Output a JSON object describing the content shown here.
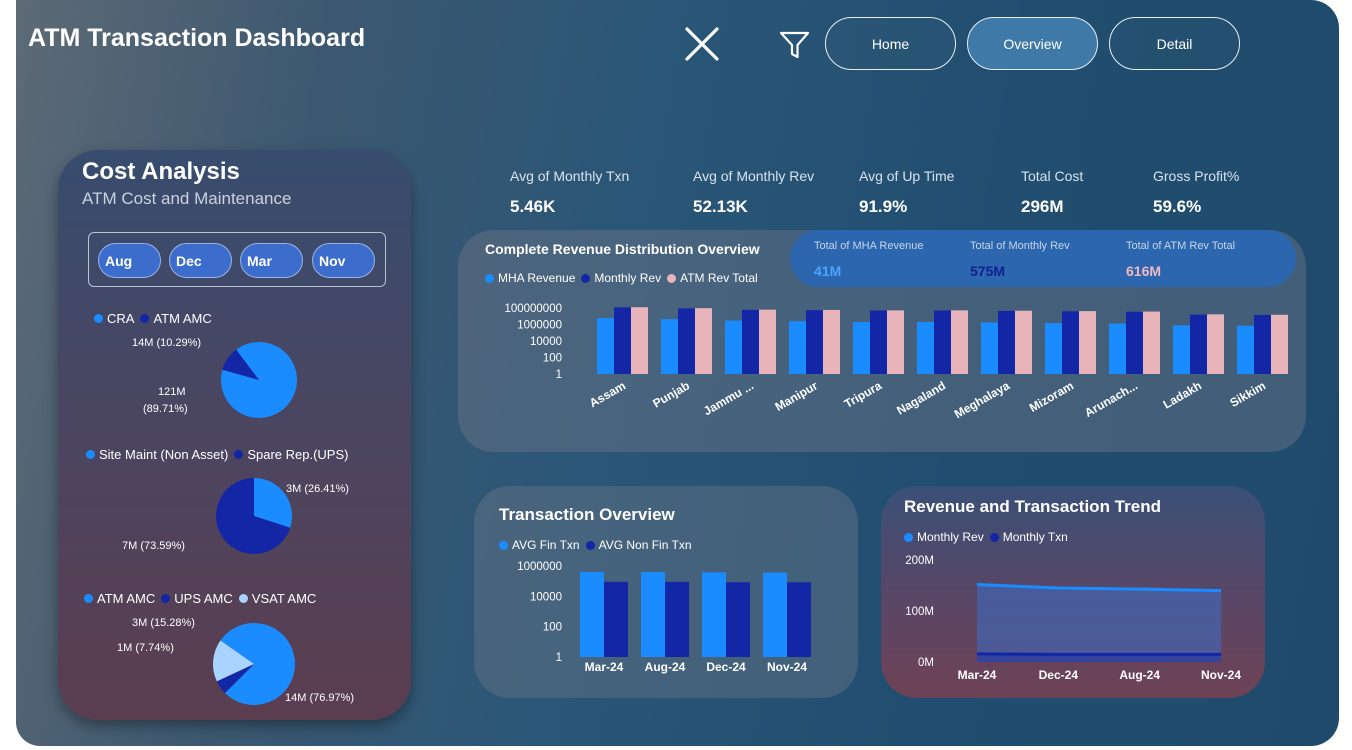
{
  "header": {
    "title": "ATM Transaction Dashboard",
    "nav": [
      {
        "label": "Home",
        "active": false
      },
      {
        "label": "Overview",
        "active": true
      },
      {
        "label": "Detail",
        "active": false
      }
    ],
    "icons": [
      "close-icon",
      "filter-icon"
    ]
  },
  "colors": {
    "bright_blue": "#1a8cff",
    "navy": "#1226a6",
    "pink": "#e8b4bb",
    "light_blue": "#a8d4ff",
    "strip_blue": "#2b66ae"
  },
  "cost_card": {
    "title": "Cost Analysis",
    "subtitle": "ATM Cost and Maintenance",
    "months": [
      "Aug",
      "Dec",
      "Mar",
      "Nov"
    ]
  },
  "kpis": [
    {
      "label": "Avg of Monthly Txn",
      "value": "5.46K"
    },
    {
      "label": "Avg of Monthly Rev",
      "value": "52.13K"
    },
    {
      "label": "Avg of Up Time",
      "value": "91.9%"
    },
    {
      "label": "Total Cost",
      "value": "296M"
    },
    {
      "label": "Gross Profit%",
      "value": "59.6%"
    }
  ],
  "revenue_strip": [
    {
      "label": "Total of MHA Revenue",
      "value": "41M",
      "color": "#4da3ff"
    },
    {
      "label": "Total of Monthly Rev",
      "value": "575M",
      "color": "#11208f"
    },
    {
      "label": "Total of ATM Rev Total",
      "value": "616M",
      "color": "#f0b8c0"
    }
  ],
  "chart_data": [
    {
      "type": "pie",
      "legend": [
        "CRA",
        "ATM AMC"
      ],
      "slices": [
        {
          "name": "CRA",
          "value": 121,
          "label_value": "121M",
          "label_pct": "(89.71%)",
          "color": "#1a8cff"
        },
        {
          "name": "ATM AMC",
          "value": 14,
          "label": "14M (10.29%)",
          "color": "#1226a6"
        }
      ]
    },
    {
      "type": "pie",
      "legend": [
        "Site Maint (Non Asset)",
        "Spare Rep.(UPS)"
      ],
      "slices": [
        {
          "name": "Site Maint (Non Asset)",
          "value": 3,
          "label": "3M (26.41%)",
          "color": "#1a8cff"
        },
        {
          "name": "Spare Rep.(UPS)",
          "value": 7,
          "label": "7M (73.59%)",
          "color": "#1226a6"
        }
      ]
    },
    {
      "type": "pie",
      "legend": [
        "ATM AMC",
        "UPS AMC",
        "VSAT AMC"
      ],
      "slices": [
        {
          "name": "ATM AMC",
          "value": 14,
          "label": "14M (76.97%)",
          "color": "#1a8cff"
        },
        {
          "name": "UPS AMC",
          "value": 1,
          "label": "1M (7.74%)",
          "color": "#1226a6"
        },
        {
          "name": "VSAT AMC",
          "value": 3,
          "label": "3M (15.28%)",
          "color": "#a8d4ff"
        }
      ]
    },
    {
      "type": "bar",
      "title": "Complete Revenue Distribution Overview",
      "yscale": "log",
      "yticks": [
        "100000000",
        "1000000",
        "10000",
        "100",
        "1"
      ],
      "categories": [
        "Assam",
        "Punjab",
        "Jammu ...",
        "Manipur",
        "Tripura",
        "Nagaland",
        "Meghalaya",
        "Mizoram",
        "Arunach...",
        "Ladakh",
        "Sikkim"
      ],
      "series": [
        {
          "name": "MHA Revenue",
          "color": "#1a8cff",
          "values": [
            6000000,
            4500000,
            3000000,
            2500000,
            2000000,
            2000000,
            1800000,
            1500000,
            1300000,
            800000,
            700000
          ]
        },
        {
          "name": "Monthly Rev",
          "color": "#1226a6",
          "values": [
            120000000,
            90000000,
            60000000,
            55000000,
            50000000,
            50000000,
            45000000,
            40000000,
            35000000,
            16000000,
            14000000
          ]
        },
        {
          "name": "ATM Rev Total",
          "color": "#e8b4bb",
          "values": [
            126000000,
            95000000,
            63000000,
            58000000,
            52000000,
            52000000,
            47000000,
            42000000,
            37000000,
            17000000,
            15000000
          ]
        }
      ]
    },
    {
      "type": "bar",
      "title": "Transaction Overview",
      "yscale": "log",
      "yticks": [
        "1000000",
        "10000",
        "100",
        "1"
      ],
      "categories": [
        "Mar-24",
        "Aug-24",
        "Dec-24",
        "Nov-24"
      ],
      "series": [
        {
          "name": "AVG Fin Txn",
          "color": "#1a8cff",
          "values": [
            400000,
            400000,
            380000,
            370000
          ]
        },
        {
          "name": "AVG Non Fin Txn",
          "color": "#1226a6",
          "values": [
            90000,
            90000,
            85000,
            85000
          ]
        }
      ]
    },
    {
      "type": "area",
      "title": "Revenue and Transaction Trend",
      "yticks": [
        "200M",
        "100M",
        "0M"
      ],
      "ylim": [
        0,
        200000000
      ],
      "categories": [
        "Mar-24",
        "Dec-24",
        "Aug-24",
        "Nov-24"
      ],
      "series": [
        {
          "name": "Monthly Rev",
          "color": "#1a8cff",
          "values": [
            152000000,
            145000000,
            143000000,
            140000000
          ]
        },
        {
          "name": "Monthly Txn",
          "color": "#1226a6",
          "values": [
            16000000,
            15000000,
            15000000,
            15000000
          ]
        }
      ]
    }
  ]
}
